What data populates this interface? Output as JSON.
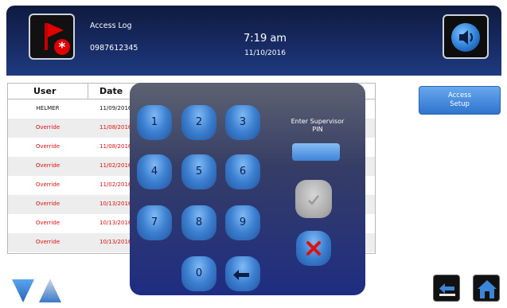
{
  "header": {
    "title": "Access Log",
    "serial": "0987612345",
    "time": "7:19 am",
    "date": "11/10/2016"
  },
  "table": {
    "columns": [
      "User",
      "Date"
    ],
    "rows": [
      {
        "user": "HELMER",
        "date": "11/09/2016",
        "color": "#111111"
      },
      {
        "user": "Override",
        "date": "11/08/2016",
        "color": "#e01010"
      },
      {
        "user": "Override",
        "date": "11/08/2016",
        "color": "#e01010"
      },
      {
        "user": "Override",
        "date": "11/02/2016",
        "color": "#e01010"
      },
      {
        "user": "Override",
        "date": "11/02/2016",
        "color": "#e01010"
      },
      {
        "user": "Override",
        "date": "10/13/2016",
        "color": "#e01010"
      },
      {
        "user": "Override",
        "date": "10/13/2016",
        "color": "#e01010"
      },
      {
        "user": "Override",
        "date": "10/13/2016",
        "color": "#e01010"
      }
    ]
  },
  "access_setup": {
    "line1": "Access",
    "line2": "Setup"
  },
  "keypad": {
    "prompt_line1": "Enter Supervisor",
    "prompt_line2": "PIN",
    "keys": [
      "1",
      "2",
      "3",
      "4",
      "5",
      "6",
      "7",
      "8",
      "9",
      "0"
    ]
  },
  "colors": {
    "header_bg": "#172a63",
    "accent_blue": "#3c7fd0",
    "override_red": "#e01010",
    "cancel_red": "#e01010"
  },
  "icons": [
    "alarm-flag-icon",
    "speaker-icon",
    "checkmark-icon",
    "cancel-x-icon",
    "backspace-icon",
    "scroll-down-icon",
    "scroll-up-icon",
    "back-icon",
    "home-icon"
  ]
}
